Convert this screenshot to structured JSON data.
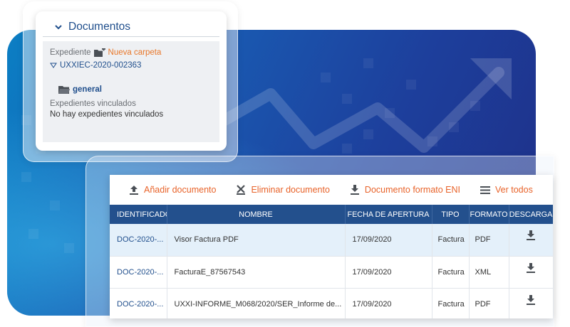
{
  "documents_card": {
    "title": "Documentos",
    "expediente_label": "Expediente",
    "new_folder_label": "Nueva carpeta",
    "expediente_id": "UXXIEC-2020-002363",
    "folder_name": "general",
    "linked_label": "Expedientes vinculados",
    "linked_empty": "No hay expedientes vinculados"
  },
  "toolbar": {
    "add": "Añadir documento",
    "remove": "Eliminar documento",
    "eni": "Documento formato ENI",
    "view_all": "Ver todos"
  },
  "table": {
    "columns": [
      "IDENTIFICADOR",
      "NOMBRE",
      "FECHA DE APERTURA",
      "TIPO",
      "FORMATO",
      "DESCARGA"
    ],
    "rows": [
      {
        "id": "DOC-2020-...",
        "name": "Visor Factura PDF",
        "date": "17/09/2020",
        "tipo": "Factura",
        "formato": "PDF"
      },
      {
        "id": "DOC-2020-...",
        "name": "FacturaE_87567543",
        "date": "17/09/2020",
        "tipo": "Factura",
        "formato": "XML"
      },
      {
        "id": "DOC-2020-...",
        "name": "UXXI-INFORME_M068/2020/SER_Informe de...",
        "date": "17/09/2020",
        "tipo": "Factura",
        "formato": "PDF"
      }
    ]
  },
  "colors": {
    "brand_blue": "#1f4e8c",
    "header_blue": "#23508d",
    "accent_orange": "#e8632a",
    "row_highlight": "#e4f0fa"
  },
  "icons": [
    "chevron-down-icon",
    "folder-plus-icon",
    "triangle-down-icon",
    "folder-icon",
    "upload-icon",
    "delete-icon",
    "download-icon",
    "menu-icon"
  ]
}
